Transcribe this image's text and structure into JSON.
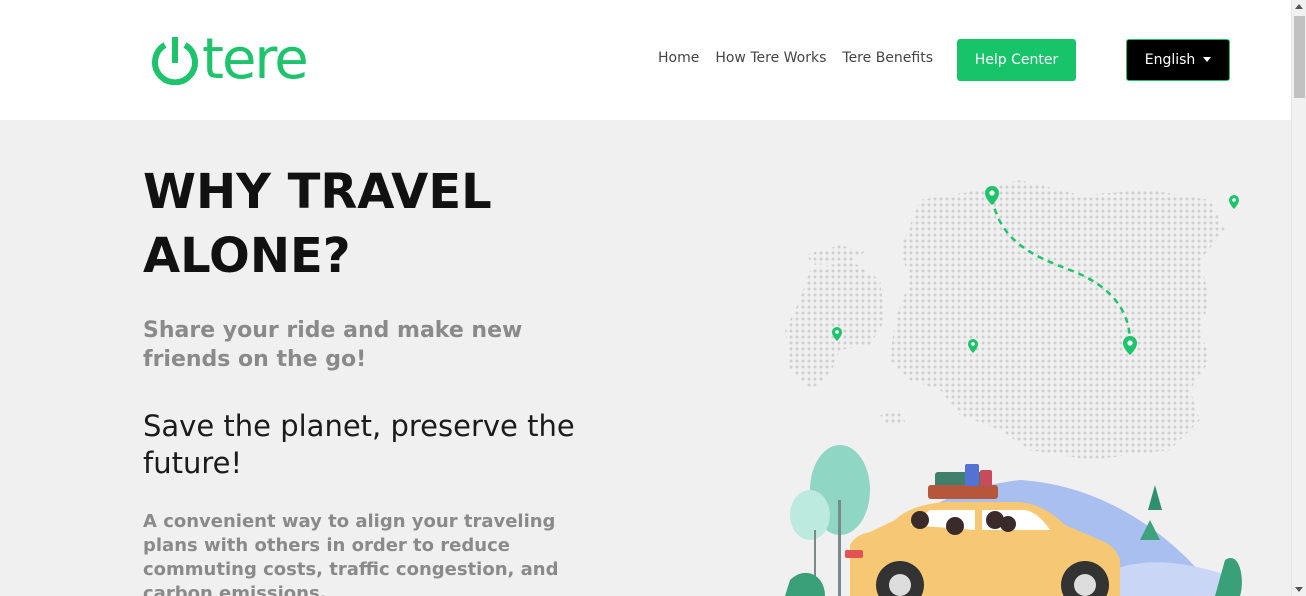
{
  "brand": {
    "name": "tere",
    "color": "#1ec46c",
    "icon": "power-icon"
  },
  "nav": {
    "items": [
      {
        "label": "Home"
      },
      {
        "label": "How Tere Works"
      },
      {
        "label": "Tere Benefits"
      }
    ],
    "help_label": "Help Center",
    "language_label": "English"
  },
  "hero": {
    "title": "WHY TRAVEL ALONE?",
    "subtitle": "Share your ride and make new friends on the go!",
    "tagline": "Save the planet, preserve the future!",
    "description": "A convenient way to align your traveling plans with others in order to reduce commuting costs, traffic congestion, and carbon emissions."
  },
  "illustration": {
    "subject": "map-and-car-icon"
  },
  "colors": {
    "accent": "#18c46a",
    "page_bg": "#f0f0f0",
    "header_bg": "#ffffff",
    "text_dark": "#111111",
    "text_muted": "#8a8a8a"
  }
}
